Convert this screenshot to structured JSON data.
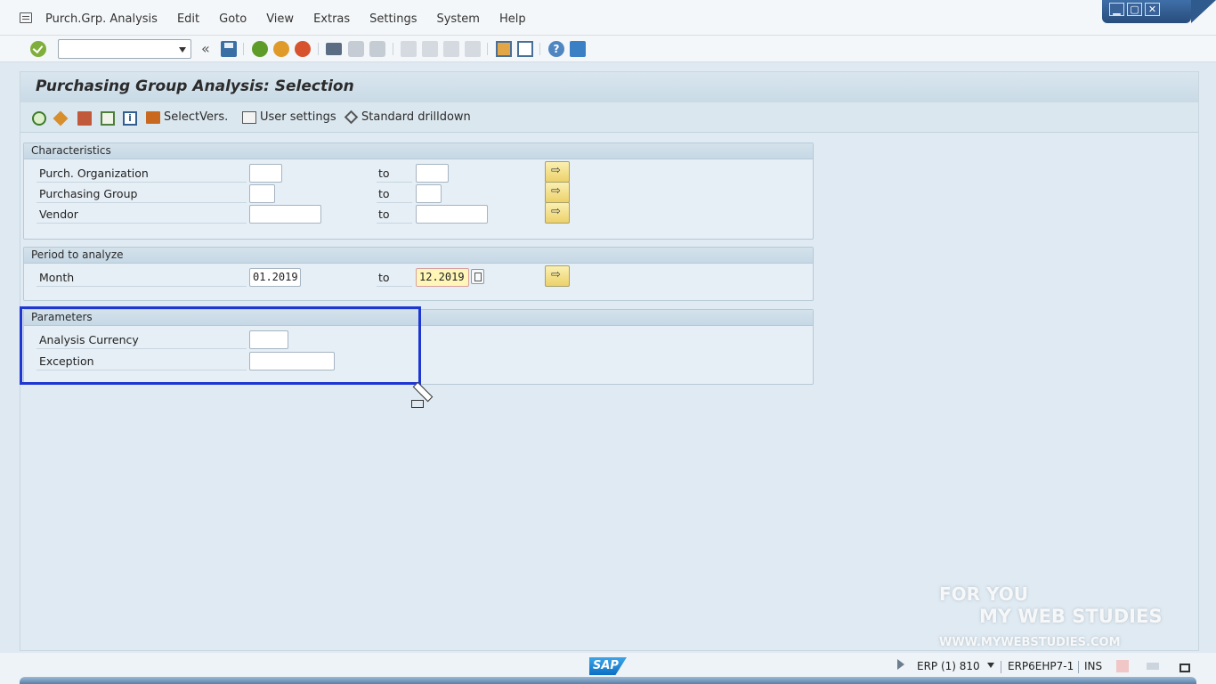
{
  "menu": {
    "items": [
      "Purch.Grp. Analysis",
      "Edit",
      "Goto",
      "View",
      "Extras",
      "Settings",
      "System",
      "Help"
    ]
  },
  "toolbar": {
    "command_field_value": "",
    "icons": [
      "check-icon",
      "save-icon",
      "back-icon",
      "exit-icon",
      "cancel-icon",
      "print-icon",
      "find-icon",
      "find-next-icon",
      "first-page-icon",
      "previous-page-icon",
      "next-page-icon",
      "last-page-icon",
      "create-session-icon",
      "shortcut-icon",
      "help-icon",
      "customize-layout-icon"
    ]
  },
  "title": "Purchasing Group Analysis: Selection",
  "app_toolbar": {
    "select_versions": "SelectVers.",
    "user_settings": "User settings",
    "standard_drilldown": "Standard drilldown"
  },
  "groups": {
    "characteristics": {
      "title": "Characteristics",
      "rows": [
        {
          "label": "Purch. Organization",
          "from": "",
          "to_label": "to",
          "to": ""
        },
        {
          "label": "Purchasing Group",
          "from": "",
          "to_label": "to",
          "to": ""
        },
        {
          "label": "Vendor",
          "from": "",
          "to_label": "to",
          "to": ""
        }
      ]
    },
    "period": {
      "title": "Period to analyze",
      "rows": [
        {
          "label": "Month",
          "from": "01.2019",
          "to_label": "to",
          "to": "12.2019"
        }
      ]
    },
    "parameters": {
      "title": "Parameters",
      "rows": [
        {
          "label": "Analysis Currency",
          "value": ""
        },
        {
          "label": "Exception",
          "value": ""
        }
      ]
    }
  },
  "status": {
    "system": "ERP (1) 810",
    "server": "ERP6EHP7-1",
    "mode": "INS",
    "logo": "SAP"
  },
  "watermark": {
    "line1": "FOR YOU",
    "line2": "MY WEB STUDIES",
    "line3": "WWW.MYWEBSTUDIES.COM"
  },
  "colors": {
    "highlight": "#1e36d2",
    "focus_field": "#fff6b8",
    "accent": "#3a6fa6"
  }
}
